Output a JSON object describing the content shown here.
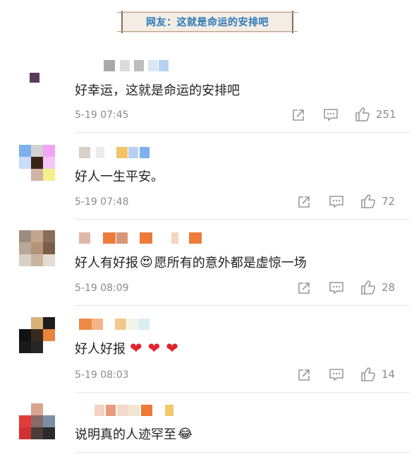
{
  "header": {
    "title": "网友：这就是命运的安排吧"
  },
  "comments": [
    {
      "text": "好幸运，这就是命运的安排吧",
      "time": "5-19 07:45",
      "likes": "251"
    },
    {
      "text": "好人一生平安。",
      "time": "5-19 07:48",
      "likes": "72"
    },
    {
      "text_a": "好人有好报",
      "emoji": "😍",
      "text_b": "愿所有的意外都是虚惊一场",
      "time": "5-19 08:09",
      "likes": "28"
    },
    {
      "text": "好人好报",
      "hearts": [
        "❤",
        "❤",
        "❤"
      ],
      "time": "5-19 08:03",
      "likes": "14"
    },
    {
      "text": "说明真的人迹罕至",
      "emoji": "😂"
    }
  ],
  "icons": {
    "share": "share-icon",
    "comment": "comment-icon",
    "like": "thumbs-up-icon"
  },
  "colors": {
    "banner_text": "#2c78b8",
    "banner_bg": "#f3ede4",
    "heart": "#e0262f"
  }
}
